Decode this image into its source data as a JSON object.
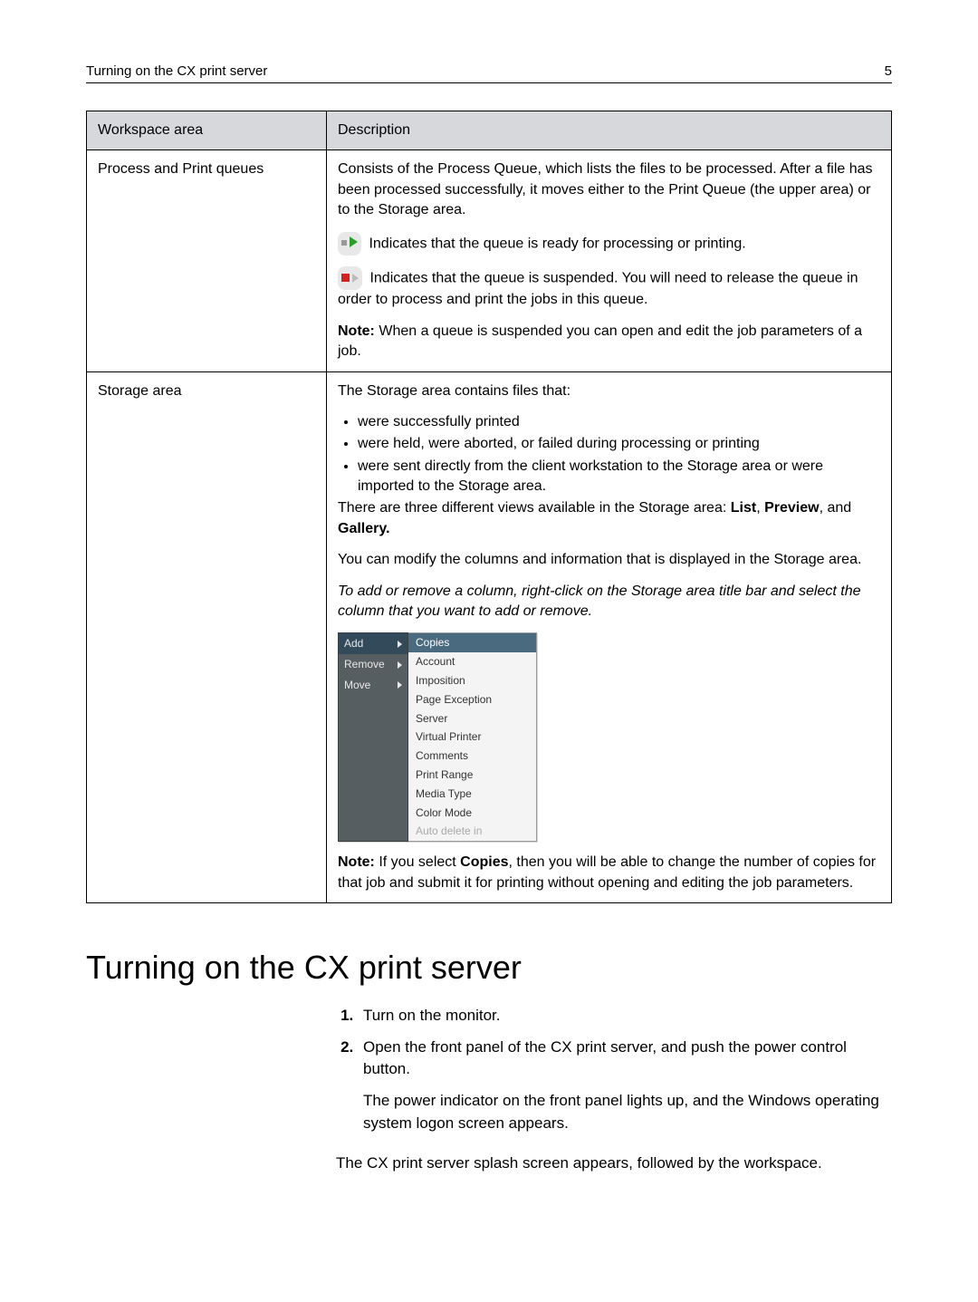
{
  "header": {
    "title": "Turning on the CX print server",
    "page": "5"
  },
  "table": {
    "col1": "Workspace area",
    "col2": "Description",
    "rows": [
      {
        "area": "Process and Print queues",
        "p1": "Consists of the Process Queue, which lists the files to be processed. After a file has been processed successfully, it moves either to the Print Queue (the upper area) or to the Storage area.",
        "p2": " Indicates that the queue is ready for processing or printing.",
        "p3": " Indicates that the queue is suspended. You will need to release the queue in order to process and print the jobs in this queue.",
        "p4a": "Note:",
        "p4b": " When a queue is suspended you can open and edit the job parameters of a job."
      },
      {
        "area": "Storage area",
        "p1": "The Storage area contains files that:",
        "b1": "were successfully printed",
        "b2": "were held, were aborted, or failed during processing or printing",
        "b3": "were sent directly from the client workstation to the Storage area or were imported to the Storage area.",
        "p2a": "There are three different views available in the Storage area: ",
        "p2b": "List",
        "p2c": ", ",
        "p2d": "Preview",
        "p2e": ", and ",
        "p2f": "Gallery.",
        "p3": "You can modify the columns and information that is displayed in the Storage area.",
        "p4": "To add or remove a column, right-click on the Storage area title bar and select the column that you want to add or remove.",
        "menu": {
          "left": [
            "Add",
            "Remove",
            "Move"
          ],
          "right": [
            "Copies",
            "Account",
            "Imposition",
            "Page Exception",
            "Server",
            "Virtual Printer",
            "Comments",
            "Print Range",
            "Media Type",
            "Color Mode",
            "Auto delete in"
          ]
        },
        "p5a": "Note:",
        "p5b": " If you select ",
        "p5c": "Copies",
        "p5d": ", then you will be able to change the number of copies for that job and submit it for printing without opening and editing the job parameters."
      }
    ]
  },
  "section": {
    "heading": "Turning on the CX print server",
    "step1": "Turn on the monitor.",
    "step2": "Open the front panel of the CX print server, and push the power control button.",
    "step2sub": "The power indicator on the front panel lights up, and the Windows operating system logon screen appears.",
    "final": "The CX print server splash screen appears, followed by the workspace."
  }
}
